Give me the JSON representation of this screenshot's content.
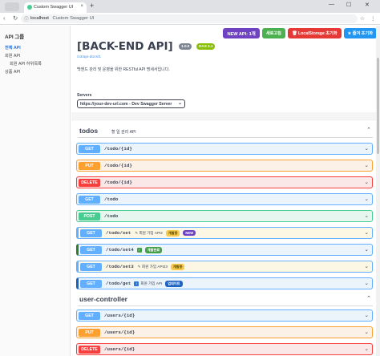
{
  "browser": {
    "tab_title": "Custom Swagger UI",
    "tab_close": "×",
    "new_tab": "+",
    "url_host": "localhost",
    "url_title": "Custom Swagger UI",
    "window_minimize": "—",
    "window_maximize": "☐",
    "window_close": "✕"
  },
  "sidebar": {
    "title": "API 그룹",
    "items": [
      {
        "label": "전체 API",
        "active": true
      },
      {
        "label": "회원 API",
        "active": false
      },
      {
        "label": "회원 API 하위목록",
        "active": false,
        "sub": true
      },
      {
        "label": "상품 API",
        "active": false
      }
    ]
  },
  "top_buttons": {
    "new_api": "NEW API: 1개",
    "refresh": "새로고침",
    "local_storage": "LocalStorage 초기화",
    "fav_reset": "즐겨 초기화"
  },
  "info": {
    "title": "[BACK-END API]",
    "version": "1.0.0",
    "oas": "OAS 3.1",
    "link": "/v3/api-docs/1",
    "description": "백엔드 관리 및 운영을 위한 RESTful API 명세서입니다."
  },
  "servers": {
    "label": "Servers",
    "selected": "https://your-dev-url.com - Dev Swagger Server"
  },
  "groups": [
    {
      "name": "todos",
      "description": "할 일 관리 API",
      "operations": [
        {
          "method": "GET",
          "path": "/todo/{id}"
        },
        {
          "method": "PUT",
          "path": "/todo/{id}"
        },
        {
          "method": "DELETE",
          "path": "/todo/{id}"
        },
        {
          "method": "GET",
          "path": "/todo"
        },
        {
          "method": "POST",
          "path": "/todo"
        },
        {
          "method": "GET",
          "path": "/todo/set",
          "summary": "✎ 회원 가입 API2",
          "badge1": "개발중",
          "badge2": "NEW"
        },
        {
          "method": "GET",
          "path": "/todo/set4",
          "badge1": "개발완료"
        },
        {
          "method": "GET",
          "path": "/todo/set3",
          "summary": "✎ 회원 가입 API23",
          "badge1": "개발중"
        },
        {
          "method": "GET",
          "path": "/todo/get",
          "summary": "회원 가입 API",
          "badge1": "업데이트"
        }
      ]
    },
    {
      "name": "user-controller",
      "description": "",
      "operations": [
        {
          "method": "GET",
          "path": "/users/{id}"
        },
        {
          "method": "PUT",
          "path": "/users/{id}"
        },
        {
          "method": "DELETE",
          "path": "/users/{id}"
        }
      ]
    }
  ],
  "colors": {
    "get": "#61affe",
    "put": "#fca130",
    "delete": "#f93e3e",
    "post": "#49cc90",
    "accent": "#6f42c1"
  }
}
